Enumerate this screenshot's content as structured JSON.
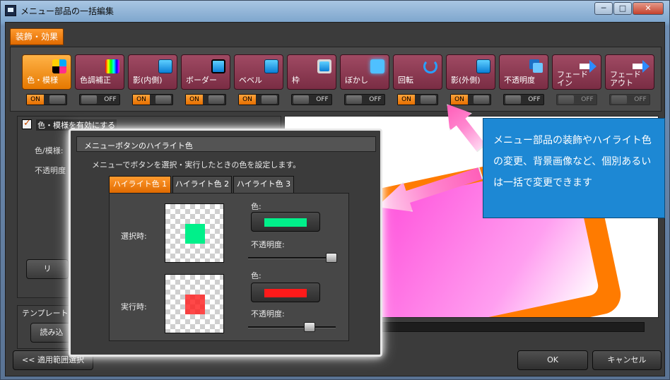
{
  "window": {
    "title": "メニュー部品の一括編集",
    "min_label": "─",
    "max_label": "□",
    "close_label": "✕"
  },
  "main_tab": "装飾・効果",
  "tools": [
    {
      "label": "色・模様",
      "icon": "color-pattern-icon",
      "state": "ON",
      "active": true
    },
    {
      "label": "色調補正",
      "icon": "color-correction-icon",
      "state": "OFF"
    },
    {
      "label": "影(内側)",
      "icon": "inner-shadow-icon",
      "state": "ON"
    },
    {
      "label": "ボーダー",
      "icon": "border-icon",
      "state": "ON"
    },
    {
      "label": "ベベル",
      "icon": "bevel-icon",
      "state": "ON"
    },
    {
      "label": "枠",
      "icon": "frame-icon",
      "state": "OFF"
    },
    {
      "label": "ぼかし",
      "icon": "blur-icon",
      "state": "OFF"
    },
    {
      "label": "回転",
      "icon": "rotate-icon",
      "state": "ON"
    },
    {
      "label": "影(外側)",
      "icon": "outer-shadow-icon",
      "state": "ON"
    },
    {
      "label": "不透明度",
      "icon": "opacity-icon",
      "state": "OFF"
    },
    {
      "label": "フェード\nイン",
      "icon": "fade-in-icon",
      "state": "OFF",
      "disabled": true
    },
    {
      "label": "フェード\nアウト",
      "icon": "fade-out-icon",
      "state": "OFF",
      "disabled": true
    }
  ],
  "toggle_on": "ON",
  "toggle_off": "OFF",
  "left_panel": {
    "enable_label": "色・模様を有効にする",
    "color_label": "色/模様:",
    "opacity_label": "不透明度",
    "reset_label": "リ"
  },
  "template": {
    "title": "テンプレート",
    "load_label": "読み込"
  },
  "callout": {
    "title": "メニューボタンのハイライト色",
    "description": "メニューでボタンを選択・実行したときの色を設定します。",
    "tabs": [
      "ハイライト色 1",
      "ハイライト色 2",
      "ハイライト色 3"
    ],
    "select_label": "選択時:",
    "exec_label": "実行時:",
    "color_label": "色:",
    "opacity_label": "不透明度:",
    "select_color": "#00f08a",
    "exec_color": "#ff1a1a",
    "select_opacity": 0.95,
    "exec_opacity": 0.7
  },
  "info_text": "メニュー部品の装飾やハイライト色の変更、背景画像など、個別あるいは一括で変更できます",
  "buttons": {
    "range_select": "<< 適用範囲選択",
    "ok": "OK",
    "cancel": "キャンセル"
  },
  "colors": {
    "accent": "#e67800",
    "tool_button": "#8a3650",
    "info_box": "#1d88d4"
  }
}
